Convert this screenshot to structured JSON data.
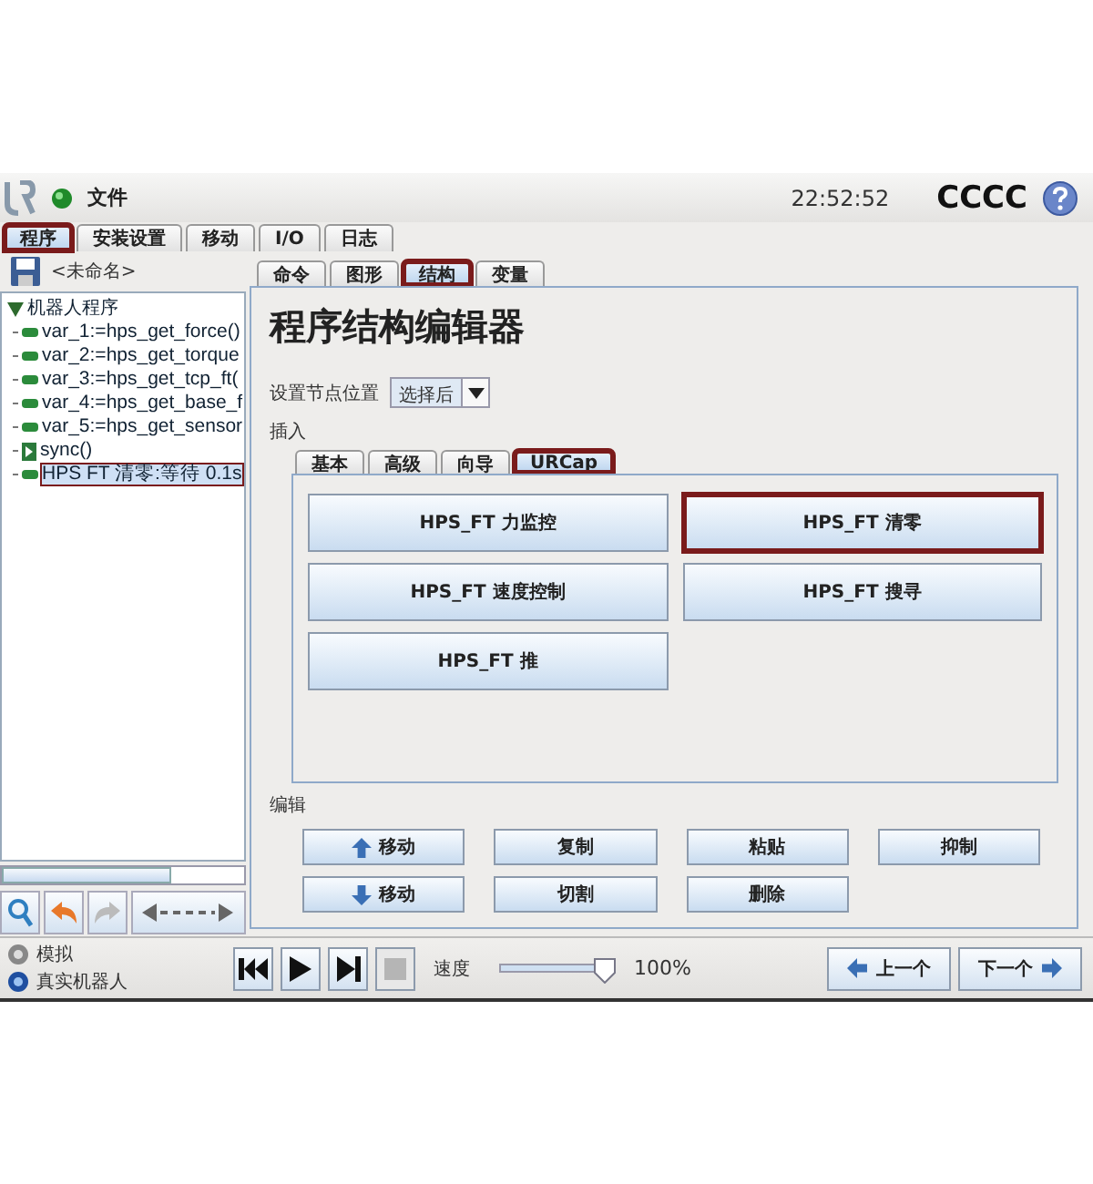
{
  "header": {
    "menu": "文件",
    "time": "22:52:52",
    "robot_name": "CCCC"
  },
  "main_tabs": [
    {
      "label": "程序",
      "selected": true,
      "highlighted": true
    },
    {
      "label": "安装设置",
      "selected": false,
      "highlighted": false
    },
    {
      "label": "移动",
      "selected": false,
      "highlighted": false
    },
    {
      "label": "I/O",
      "selected": false,
      "highlighted": false
    },
    {
      "label": "日志",
      "selected": false,
      "highlighted": false
    }
  ],
  "program": {
    "name": "<未命名>",
    "tree": [
      {
        "label": "机器人程序",
        "kind": "root",
        "expanded": true,
        "selected": false,
        "highlighted": false,
        "children": [
          {
            "label": "var_1:=hps_get_force()",
            "kind": "assign",
            "selected": false,
            "highlighted": false
          },
          {
            "label": "var_2:=hps_get_torque",
            "kind": "assign",
            "selected": false,
            "highlighted": false
          },
          {
            "label": "var_3:=hps_get_tcp_ft(",
            "kind": "assign",
            "selected": false,
            "highlighted": false
          },
          {
            "label": "var_4:=hps_get_base_f",
            "kind": "assign",
            "selected": false,
            "highlighted": false
          },
          {
            "label": "var_5:=hps_get_sensor",
            "kind": "assign",
            "selected": false,
            "highlighted": false
          },
          {
            "label": "sync()",
            "kind": "sync",
            "selected": false,
            "highlighted": false
          },
          {
            "label": "HPS FT 清零:等待 0.1s",
            "kind": "assign",
            "selected": true,
            "highlighted": true
          }
        ]
      }
    ]
  },
  "editor_tabs": [
    {
      "label": "命令",
      "selected": false,
      "highlighted": false
    },
    {
      "label": "图形",
      "selected": false,
      "highlighted": false
    },
    {
      "label": "结构",
      "selected": true,
      "highlighted": true
    },
    {
      "label": "变量",
      "selected": false,
      "highlighted": false
    }
  ],
  "editor": {
    "title": "程序结构编辑器",
    "position_label": "设置节点位置",
    "position_value": "选择后",
    "insert_label": "插入",
    "insert_tabs": [
      {
        "label": "基本",
        "selected": false,
        "highlighted": false
      },
      {
        "label": "高级",
        "selected": false,
        "highlighted": false
      },
      {
        "label": "向导",
        "selected": false,
        "highlighted": false
      },
      {
        "label": "URCap",
        "selected": true,
        "highlighted": true
      }
    ],
    "insert_buttons": [
      {
        "label": "HPS_FT 力监控",
        "highlighted": false
      },
      {
        "label": "HPS_FT 清零",
        "highlighted": true
      },
      {
        "label": "HPS_FT 速度控制",
        "highlighted": false
      },
      {
        "label": "HPS_FT 搜寻",
        "highlighted": false
      },
      {
        "label": "HPS_FT 推",
        "highlighted": false
      }
    ],
    "edit_label": "编辑",
    "edit_buttons": [
      {
        "label": "移动",
        "kind": "up"
      },
      {
        "label": "复制",
        "kind": "plain"
      },
      {
        "label": "粘贴",
        "kind": "plain"
      },
      {
        "label": "抑制",
        "kind": "plain"
      },
      {
        "label": "移动",
        "kind": "down"
      },
      {
        "label": "切割",
        "kind": "plain"
      },
      {
        "label": "删除",
        "kind": "plain"
      }
    ]
  },
  "modes": [
    {
      "label": "模拟",
      "selected": false
    },
    {
      "label": "真实机器人",
      "selected": true
    }
  ],
  "playback": {
    "stop_disabled": true
  },
  "speed": {
    "label": "速度",
    "level": 1,
    "reading": "100%"
  },
  "nav": {
    "previous": "上一个",
    "next": "下一个"
  }
}
